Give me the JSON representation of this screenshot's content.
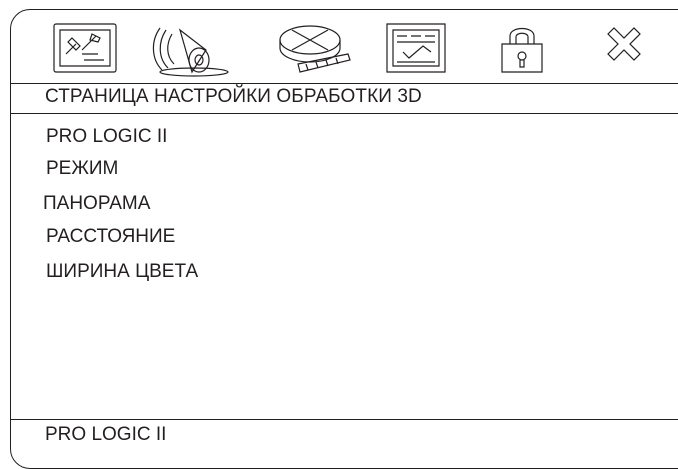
{
  "toolbar": {
    "icons": [
      "general-setup-icon",
      "audio-speaker-icon",
      "video-film-icon",
      "preference-panel-icon",
      "password-lock-icon",
      "exit-x-icon"
    ]
  },
  "page": {
    "title": "СТРАНИЦА НАСТРОЙКИ ОБРАБОТКИ 3D"
  },
  "menu": {
    "items": [
      {
        "label": "PRO LOGIC II"
      },
      {
        "label": "РЕЖИМ"
      },
      {
        "label": "ПАНОРАМА"
      },
      {
        "label": "РАССТОЯНИЕ"
      },
      {
        "label": "ШИРИНА ЦВЕТА"
      }
    ]
  },
  "status": {
    "text": "PRO LOGIC II"
  }
}
